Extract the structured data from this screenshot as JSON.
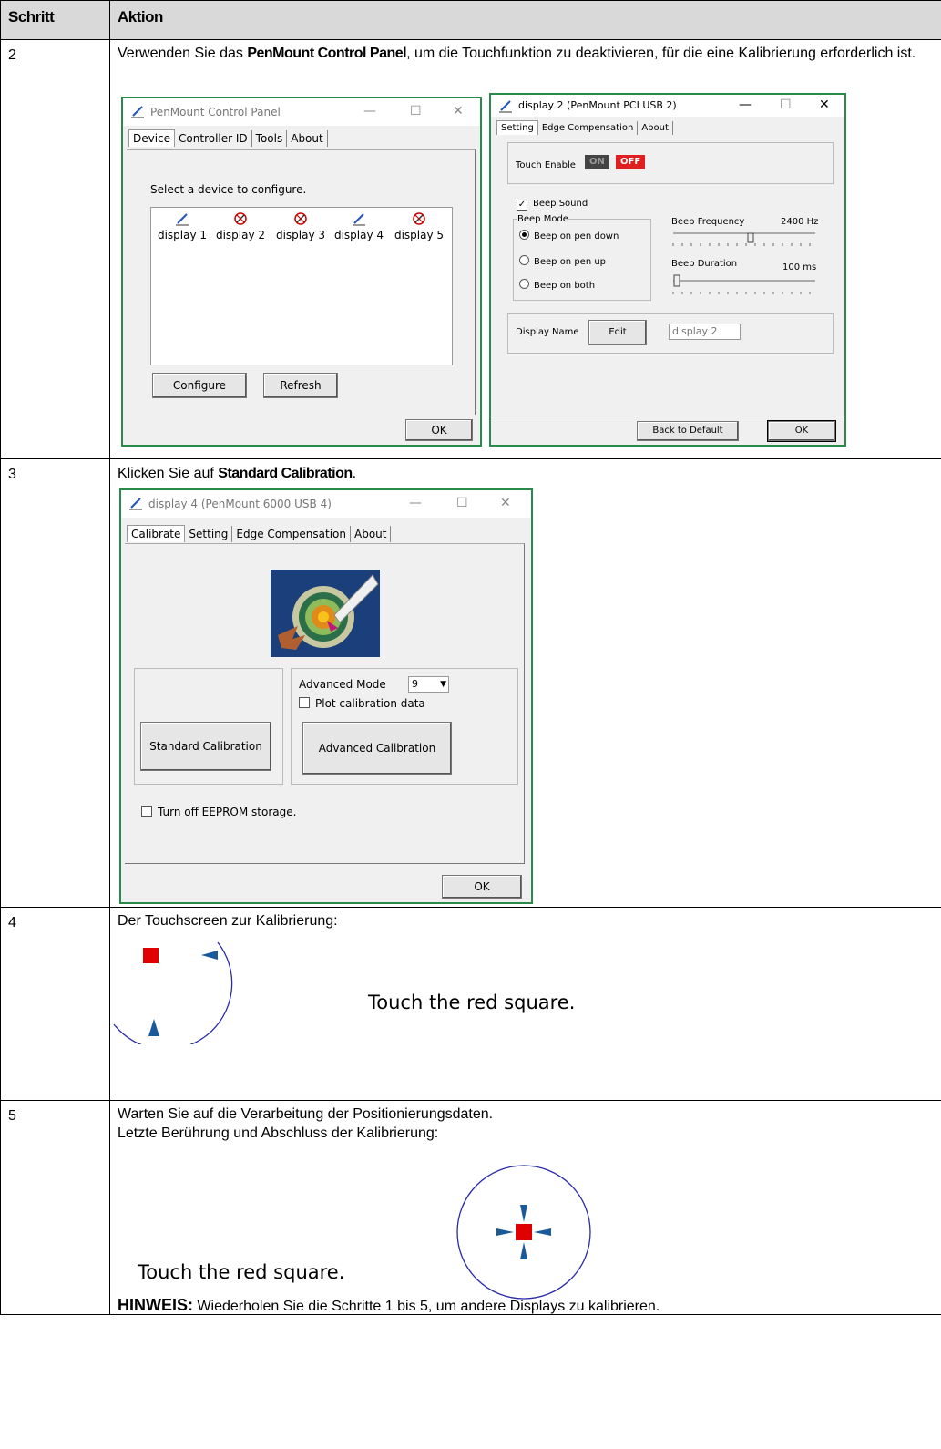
{
  "table": {
    "col_step": "Schritt",
    "col_action": "Aktion"
  },
  "step2": {
    "num": "2",
    "text_pre": "Verwenden Sie das ",
    "text_bold": "PenMount Control Panel",
    "text_post": ", um die Touchfunktion zu deaktivieren, für die eine Kalibrierung erforderlich ist.",
    "control_panel": {
      "title": "PenMount Control Panel",
      "tabs": [
        "Device",
        "Controller ID",
        "Tools",
        "About"
      ],
      "prompt": "Select a device to configure.",
      "devices": [
        "display 1",
        "display 2",
        "display 3",
        "display 4",
        "display 5"
      ],
      "configure": "Configure",
      "refresh": "Refresh",
      "ok": "OK"
    },
    "display2": {
      "title": "display 2 (PenMount PCI USB 2)",
      "tabs": [
        "Setting",
        "Edge Compensation",
        "About"
      ],
      "touch_enable": "Touch Enable",
      "on": "ON",
      "off": "OFF",
      "beep_sound": "Beep Sound",
      "beep_mode": "Beep Mode",
      "beep_options": [
        "Beep on pen down",
        "Beep on pen up",
        "Beep on both"
      ],
      "beep_frequency": "Beep Frequency",
      "freq_value": "2400 Hz",
      "beep_duration": "Beep Duration",
      "duration_value": "100  ms",
      "display_name": "Display Name",
      "edit": "Edit",
      "name_value": "display 2",
      "back_default": "Back to Default",
      "ok": "OK"
    }
  },
  "step3": {
    "num": "3",
    "text_pre": "Klicken Sie auf ",
    "text_bold": "Standard Calibration",
    "text_post": ".",
    "window": {
      "title": "display 4 (PenMount 6000 USB 4)",
      "tabs": [
        "Calibrate",
        "Setting",
        "Edge Compensation",
        "About"
      ],
      "advanced_mode": "Advanced Mode",
      "mode_value": "9",
      "plot_data": "Plot calibration data",
      "standard": "Standard Calibration",
      "advanced": "Advanced Calibration",
      "eeprom": "Turn off EEPROM storage.",
      "ok": "OK"
    }
  },
  "step4": {
    "num": "4",
    "text": "Der Touchscreen zur Kalibrierung:",
    "touch": "Touch the red square."
  },
  "step5": {
    "num": "5",
    "line1": "Warten Sie auf die Verarbeitung der Positionierungsdaten.",
    "line2": "Letzte Berührung und Abschluss der Kalibrierung:",
    "touch": "Touch the red square.",
    "note_label": "HINWEIS:",
    "note_text": " Wiederholen Sie die Schritte 1 bis 5, um andere Displays zu kalibrieren."
  }
}
